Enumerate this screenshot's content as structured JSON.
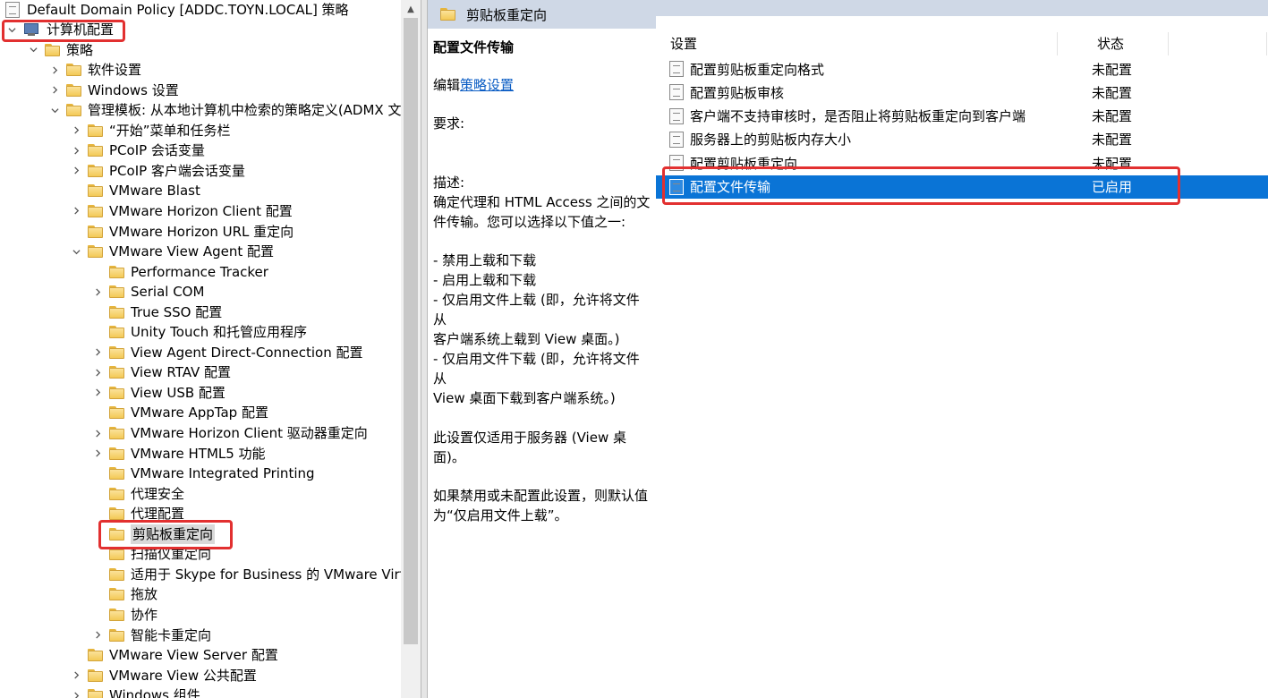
{
  "tree": {
    "root": "Default Domain Policy [ADDC.TOYN.LOCAL] 策略",
    "items": [
      {
        "label": "计算机配置",
        "level": 0,
        "chev": "down",
        "icon": "computer"
      },
      {
        "label": "策略",
        "level": 1,
        "chev": "down",
        "icon": "folder"
      },
      {
        "label": "软件设置",
        "level": 2,
        "chev": "right",
        "icon": "folder"
      },
      {
        "label": "Windows 设置",
        "level": 2,
        "chev": "right",
        "icon": "folder"
      },
      {
        "label": "管理模板: 从本地计算机中检索的策略定义(ADMX 文件",
        "level": 2,
        "chev": "down",
        "icon": "folder"
      },
      {
        "label": "“开始”菜单和任务栏",
        "level": 3,
        "chev": "right",
        "icon": "folder"
      },
      {
        "label": "PCoIP 会话变量",
        "level": 3,
        "chev": "right",
        "icon": "folder"
      },
      {
        "label": "PCoIP 客户端会话变量",
        "level": 3,
        "chev": "right",
        "icon": "folder"
      },
      {
        "label": "VMware Blast",
        "level": 3,
        "chev": "",
        "icon": "folder"
      },
      {
        "label": "VMware Horizon Client 配置",
        "level": 3,
        "chev": "right",
        "icon": "folder"
      },
      {
        "label": "VMware Horizon URL 重定向",
        "level": 3,
        "chev": "",
        "icon": "folder"
      },
      {
        "label": "VMware View Agent 配置",
        "level": 3,
        "chev": "down",
        "icon": "folder"
      },
      {
        "label": "Performance Tracker",
        "level": 4,
        "chev": "",
        "icon": "folder"
      },
      {
        "label": "Serial COM",
        "level": 4,
        "chev": "right",
        "icon": "folder"
      },
      {
        "label": "True SSO 配置",
        "level": 4,
        "chev": "",
        "icon": "folder"
      },
      {
        "label": "Unity Touch 和托管应用程序",
        "level": 4,
        "chev": "",
        "icon": "folder"
      },
      {
        "label": "View Agent Direct-Connection 配置",
        "level": 4,
        "chev": "right",
        "icon": "folder"
      },
      {
        "label": "View RTAV 配置",
        "level": 4,
        "chev": "right",
        "icon": "folder"
      },
      {
        "label": "View USB 配置",
        "level": 4,
        "chev": "right",
        "icon": "folder"
      },
      {
        "label": "VMware AppTap 配置",
        "level": 4,
        "chev": "",
        "icon": "folder"
      },
      {
        "label": "VMware Horizon Client 驱动器重定向",
        "level": 4,
        "chev": "right",
        "icon": "folder"
      },
      {
        "label": "VMware HTML5 功能",
        "level": 4,
        "chev": "right",
        "icon": "folder"
      },
      {
        "label": "VMware Integrated Printing",
        "level": 4,
        "chev": "",
        "icon": "folder"
      },
      {
        "label": "代理安全",
        "level": 4,
        "chev": "",
        "icon": "folder"
      },
      {
        "label": "代理配置",
        "level": 4,
        "chev": "",
        "icon": "folder"
      },
      {
        "label": "剪贴板重定向",
        "level": 4,
        "chev": "",
        "icon": "folder",
        "selected": true
      },
      {
        "label": "扫描仪重定向",
        "level": 4,
        "chev": "",
        "icon": "folder"
      },
      {
        "label": "适用于 Skype for Business 的 VMware Virtualiz",
        "level": 4,
        "chev": "",
        "icon": "folder"
      },
      {
        "label": "拖放",
        "level": 4,
        "chev": "",
        "icon": "folder"
      },
      {
        "label": "协作",
        "level": 4,
        "chev": "",
        "icon": "folder"
      },
      {
        "label": "智能卡重定向",
        "level": 4,
        "chev": "right",
        "icon": "folder"
      },
      {
        "label": "VMware View Server 配置",
        "level": 3,
        "chev": "",
        "icon": "folder"
      },
      {
        "label": "VMware View 公共配置",
        "level": 3,
        "chev": "right",
        "icon": "folder"
      },
      {
        "label": "Windows 组件",
        "level": 3,
        "chev": "right",
        "icon": "folder"
      }
    ]
  },
  "header": {
    "title": "剪贴板重定向"
  },
  "description": {
    "title": "配置文件传输",
    "edit_prefix": "编辑",
    "edit_link": "策略设置",
    "requirements": "要求:",
    "desc_label": "描述:",
    "desc_lines": [
      "确定代理和 HTML Access 之间的文",
      "件传输。您可以选择以下值之一:",
      "",
      "- 禁用上载和下载",
      "- 启用上载和下载",
      "- 仅启用文件上载 (即，允许将文件从",
      "客户端系统上载到 View 桌面。)",
      "- 仅启用文件下载 (即，允许将文件从",
      "View 桌面下载到客户端系统。)",
      "",
      "此设置仅适用于服务器 (View 桌面)。",
      "",
      "如果禁用或未配置此设置，则默认值",
      "为“仅启用文件上载”。"
    ]
  },
  "list": {
    "col_setting": "设置",
    "col_state": "状态",
    "items": [
      {
        "name": "配置剪贴板重定向格式",
        "state": "未配置"
      },
      {
        "name": "配置剪贴板审核",
        "state": "未配置"
      },
      {
        "name": "客户端不支持审核时，是否阻止将剪贴板重定向到客户端",
        "state": "未配置"
      },
      {
        "name": "服务器上的剪贴板内存大小",
        "state": "未配置"
      },
      {
        "name": "配置剪贴板重定向",
        "state": "未配置"
      },
      {
        "name": "配置文件传输",
        "state": "已启用",
        "selected": true
      }
    ]
  },
  "colors": {
    "accent": "#0a74d6",
    "highlight": "#e23030",
    "header": "#cfd8e6"
  }
}
